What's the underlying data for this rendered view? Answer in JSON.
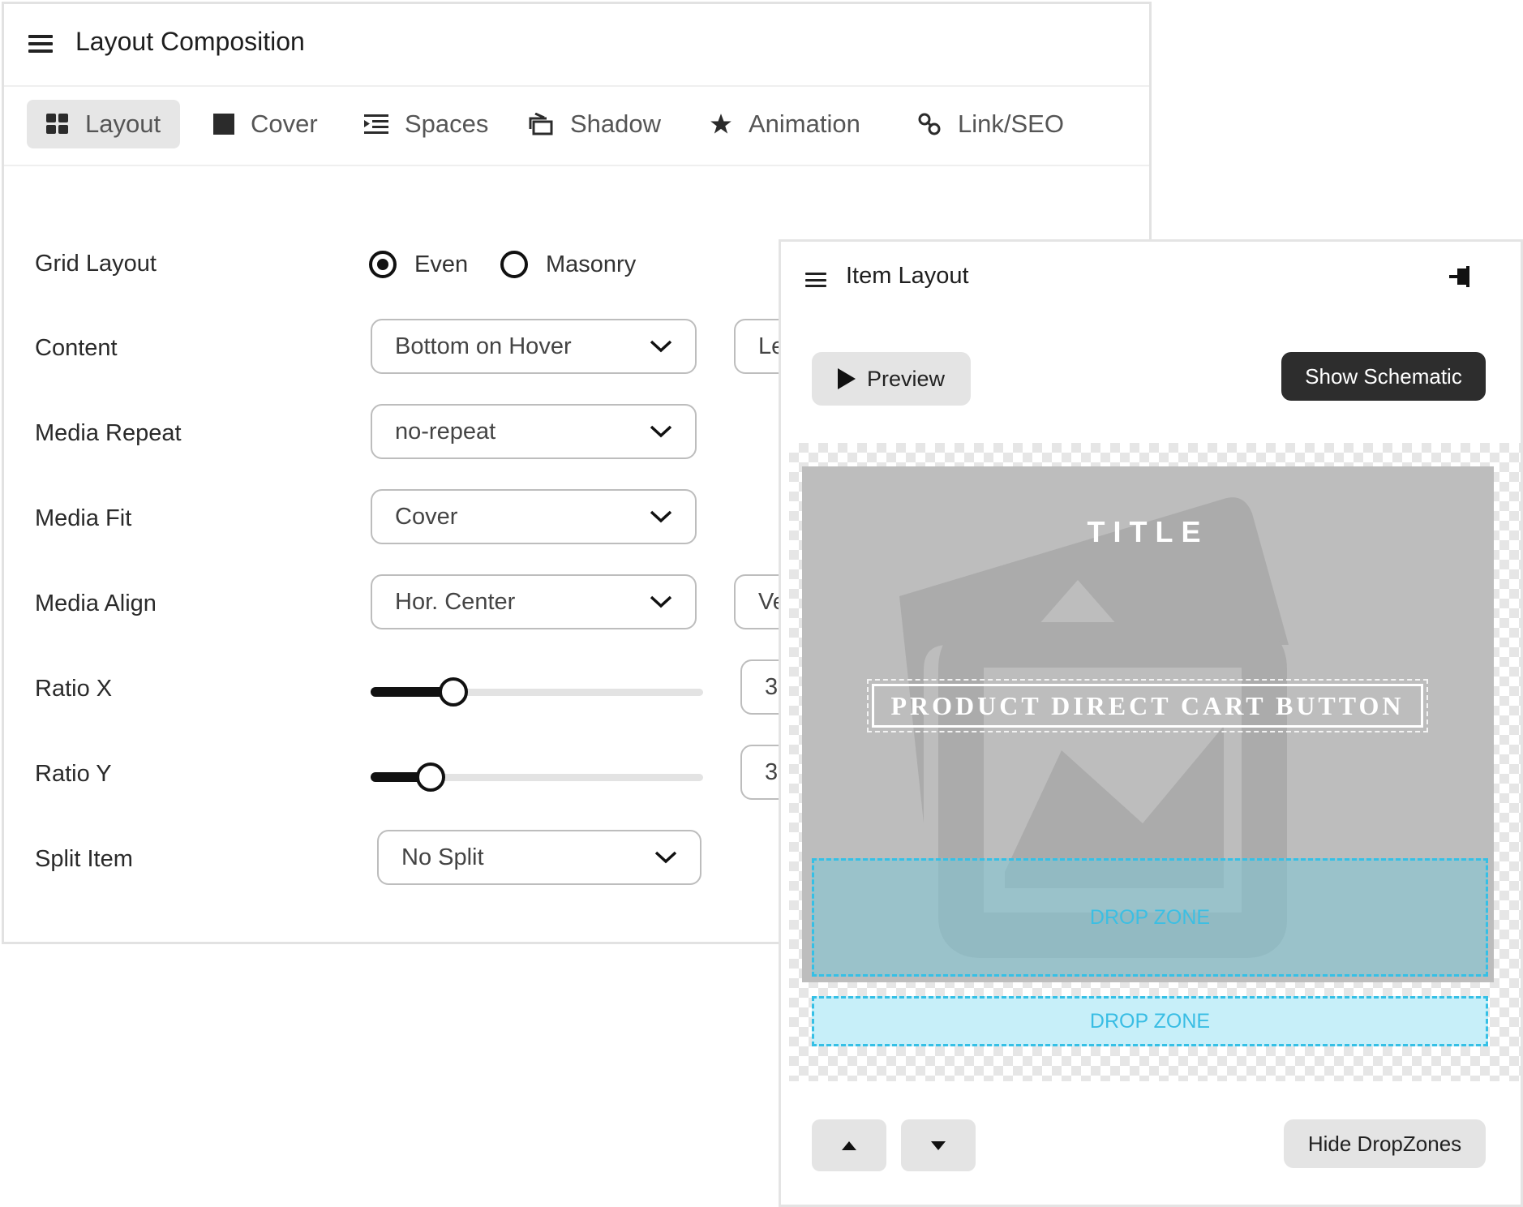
{
  "composition": {
    "title": "Layout Composition",
    "tabs": [
      {
        "label": "Layout",
        "icon": "grid-icon",
        "active": true
      },
      {
        "label": "Cover",
        "icon": "square-icon"
      },
      {
        "label": "Spaces",
        "icon": "indent-list-icon"
      },
      {
        "label": "Shadow",
        "icon": "layers-icon"
      },
      {
        "label": "Animation",
        "icon": "star-icon"
      },
      {
        "label": "Link/SEO",
        "icon": "link-icon"
      }
    ],
    "grid_layout": {
      "label": "Grid Layout",
      "options": [
        "Even",
        "Masonry"
      ],
      "selected": "Even"
    },
    "content": {
      "label": "Content",
      "value": "Bottom on Hover",
      "secondary_value": "Le"
    },
    "media_repeat": {
      "label": "Media Repeat",
      "value": "no-repeat"
    },
    "media_fit": {
      "label": "Media Fit",
      "value": "Cover"
    },
    "media_align": {
      "label": "Media Align",
      "value": "Hor. Center",
      "secondary_value": "Ve"
    },
    "ratio_x": {
      "label": "Ratio X",
      "fraction": 0.24,
      "value": "3"
    },
    "ratio_y": {
      "label": "Ratio Y",
      "fraction": 0.17,
      "value": "3"
    },
    "split_item": {
      "label": "Split Item",
      "value": "No Split"
    }
  },
  "item_layout": {
    "title": "Item Layout",
    "preview_label": "Preview",
    "show_schematic_label": "Show Schematic",
    "canvas": {
      "title_text": "TITLE",
      "cart_button_text": "PRODUCT DIRECT CART BUTTON",
      "drop_zone_inner": "DROP ZONE",
      "drop_zone_outer": "DROP ZONE"
    },
    "hide_dropzones_label": "Hide DropZones"
  },
  "colors": {
    "accent_dark": "#2d2d2d",
    "drop_zone_border": "#35c0e6",
    "drop_zone_fill": "#c7eff9",
    "media_placeholder": "#bdbdbd"
  }
}
